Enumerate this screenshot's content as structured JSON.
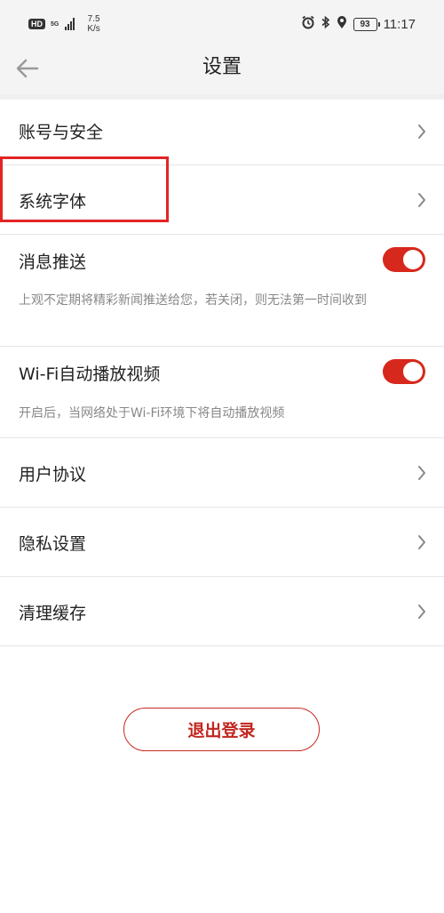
{
  "status_bar": {
    "hd": "HD",
    "signal_label": "5G",
    "speed_value": "7.5",
    "speed_unit": "K/s",
    "battery": "93",
    "time": "11:17",
    "icons": [
      "alarm-icon",
      "bluetooth-icon",
      "location-icon",
      "battery-icon"
    ]
  },
  "header": {
    "title": "设置",
    "back_icon": "back-arrow-icon"
  },
  "settings": {
    "account_security": "账号与安全",
    "system_font": "系统字体",
    "push": {
      "label": "消息推送",
      "desc": "上观不定期将精彩新闻推送给您，若关闭，则无法第一时间收到",
      "enabled": true
    },
    "wifi_autoplay": {
      "label": "Wi-Fi自动播放视频",
      "desc": "开启后，当网络处于Wi-Fi环境下将自动播放视频",
      "enabled": true
    },
    "user_agreement": "用户协议",
    "privacy_settings": "隐私设置",
    "clear_cache": "清理缓存"
  },
  "logout_label": "退出登录",
  "colors": {
    "accent": "#d7281d",
    "highlight_box": "#e22424",
    "header_bg": "#f4f4f4"
  }
}
